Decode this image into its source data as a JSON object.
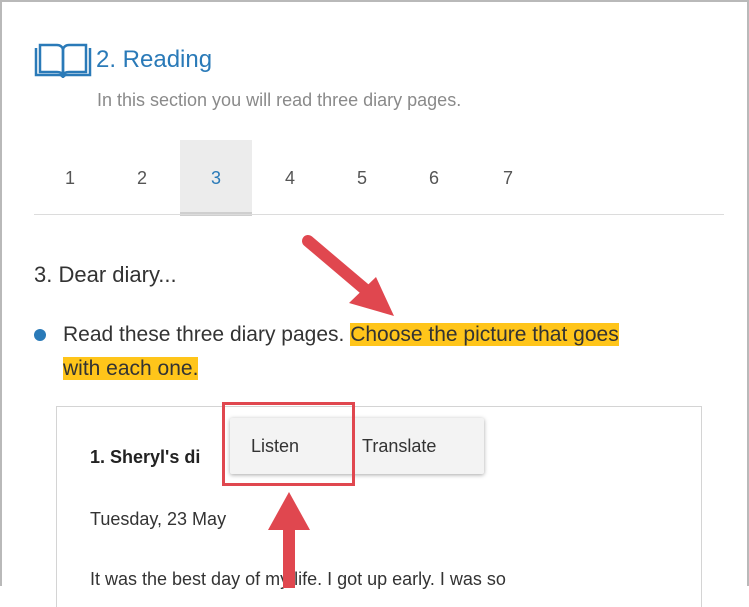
{
  "section": {
    "title": "2. Reading",
    "subtitle": "In this section you will read three diary pages.",
    "icon": "book-icon"
  },
  "tabs": [
    {
      "label": "1",
      "active": false
    },
    {
      "label": "2",
      "active": false
    },
    {
      "label": "3",
      "active": true
    },
    {
      "label": "4",
      "active": false
    },
    {
      "label": "5",
      "active": false
    },
    {
      "label": "6",
      "active": false
    },
    {
      "label": "7",
      "active": false
    }
  ],
  "exercise": {
    "title": "3. Dear diary...",
    "instruction_plain": "Read these three diary pages. ",
    "instruction_highlighted_1": "Choose the picture that goes",
    "instruction_highlighted_2": "with each one."
  },
  "card": {
    "title": "1. Sheryl's di",
    "date": "Tuesday, 23 May",
    "body_1": "It was the best day",
    "body_2": " of my life. I got up early. I was so"
  },
  "popup": {
    "listen_label": "Listen",
    "translate_label": "Translate"
  },
  "colors": {
    "accent": "#2a7ab8",
    "highlight": "#ffc51a",
    "annotation": "#e0474f"
  }
}
